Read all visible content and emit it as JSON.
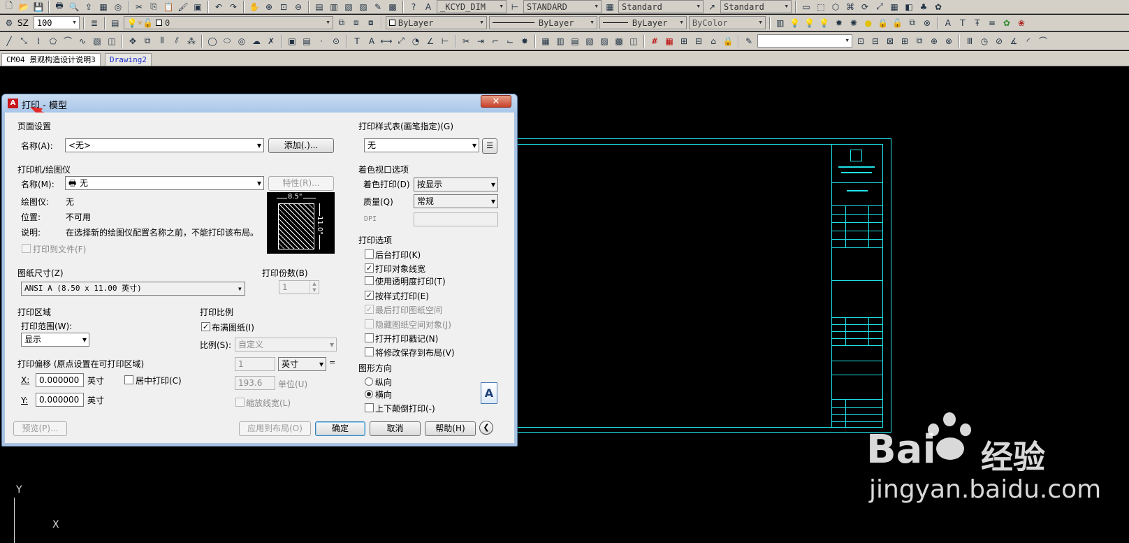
{
  "toolbar": {
    "textstyle": "_KCYD_DIM",
    "dimstyle": "STANDARD",
    "tablestyle": "Standard",
    "mleaderstyle": "Standard",
    "ws_label": "SZ",
    "zoom_value": "100",
    "layer_value": "0",
    "color": "ByLayer",
    "linetype": "ByLayer",
    "lineweight": "ByLayer",
    "plotstyle": "ByColor"
  },
  "tabs": [
    "CM04 景观构造设计说明3",
    "Drawing2"
  ],
  "dialog": {
    "title": "打印 - 模型",
    "page_setup": {
      "group": "页面设置",
      "name_label": "名称(A):",
      "name_value": "<无>",
      "add_button": "添加(.)..."
    },
    "printer": {
      "group": "打印机/绘图仪",
      "name_label": "名称(M):",
      "name_value": "无",
      "properties_button": "特性(R)...",
      "plotter_label": "绘图仪:",
      "plotter_value": "无",
      "where_label": "位置:",
      "where_value": "不可用",
      "desc_label": "说明:",
      "desc_value": "在选择新的绘图仪配置名称之前，不能打印该布局。",
      "plot_to_file": "打印到文件(F)",
      "preview_width": "8.5\"",
      "preview_height": "11.0\""
    },
    "paper": {
      "group": "图纸尺寸(Z)",
      "value": "ANSI A (8.50 x 11.00 英寸)"
    },
    "copies": {
      "group": "打印份数(B)",
      "value": "1"
    },
    "area": {
      "group": "打印区域",
      "range_label": "打印范围(W):",
      "range_value": "显示"
    },
    "offset": {
      "group": "打印偏移 (原点设置在可打印区域)",
      "x_label": "X:",
      "x_value": "0.000000",
      "y_label": "Y:",
      "y_value": "0.000000",
      "unit": "英寸",
      "center": "居中打印(C)"
    },
    "scale": {
      "group": "打印比例",
      "fit": "布满图纸(I)",
      "scale_label": "比例(S):",
      "scale_value": "自定义",
      "num": "1",
      "unit": "英寸",
      "den": "193.6",
      "unit2": "单位(U)",
      "lw": "缩放线宽(L)"
    },
    "style_table": {
      "group": "打印样式表(画笔指定)(G)",
      "value": "无"
    },
    "shaded": {
      "group": "着色视口选项",
      "shade_label": "着色打印(D)",
      "shade_value": "按显示",
      "quality_label": "质量(Q)",
      "quality_value": "常规",
      "dpi_label": "DPI"
    },
    "options": {
      "group": "打印选项",
      "items": [
        "后台打印(K)",
        "打印对象线宽",
        "使用透明度打印(T)",
        "按样式打印(E)",
        "最后打印图纸空间",
        "隐藏图纸空间对象(J)",
        "打开打印戳记(N)",
        "将修改保存到布局(V)"
      ]
    },
    "orientation": {
      "group": "图形方向",
      "portrait": "纵向",
      "landscape": "横向",
      "upside": "上下颠倒打印(-)",
      "icon_letter": "A"
    },
    "buttons": {
      "preview": "预览(P)...",
      "apply": "应用到布局(O)",
      "ok": "确定",
      "cancel": "取消",
      "help": "帮助(H)"
    }
  },
  "ucs": {
    "y": "Y",
    "x": "X"
  },
  "watermark": {
    "brand": "Bai",
    "brand2": "经验",
    "url": "jingyan.baidu.com"
  }
}
